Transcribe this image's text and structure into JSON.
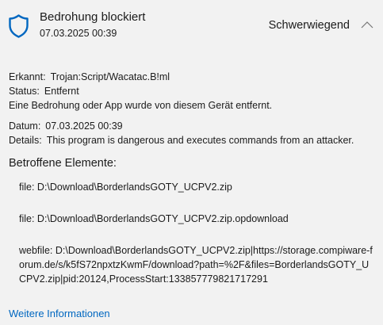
{
  "header": {
    "title": "Bedrohung blockiert",
    "subtitle": "07.03.2025 00:39",
    "severity": "Schwerwiegend",
    "icon": "shield-icon",
    "collapse_icon": "chevron-up-icon",
    "accent_color": "#0067c0"
  },
  "details": {
    "detected_label": "Erkannt:",
    "detected_value": "Trojan:Script/Wacatac.B!ml",
    "status_label": "Status:",
    "status_value": "Entfernt",
    "status_description": "Eine Bedrohung oder App wurde von diesem Gerät entfernt.",
    "date_label": "Datum:",
    "date_value": "07.03.2025 00:39",
    "details_label": "Details:",
    "details_value": "This program is dangerous and executes commands from an attacker."
  },
  "affected": {
    "title": "Betroffene Elemente:",
    "items": [
      "file: D:\\Download\\BorderlandsGOTY_UCPV2.zip",
      "file: D:\\Download\\BorderlandsGOTY_UCPV2.zip.opdownload",
      "webfile: D:\\Download\\BorderlandsGOTY_UCPV2.zip|https://storage.compiware-forum.de/s/k5fS72npxtzKwmF/download?path=%2F&files=BorderlandsGOTY_UCPV2.zip|pid:20124,ProcessStart:133857779821717291"
    ]
  },
  "footer": {
    "more_info_link": "Weitere Informationen"
  }
}
